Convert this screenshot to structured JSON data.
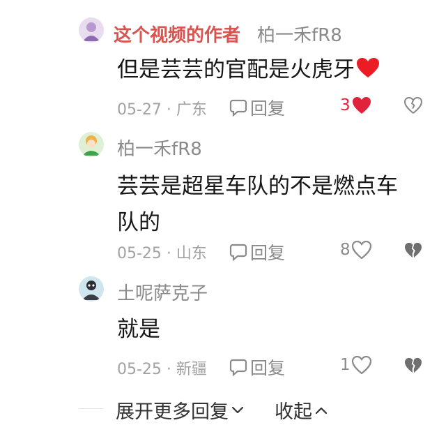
{
  "comments": [
    {
      "author_tag": "这个视频的作者",
      "reply_to": "柏一禾fR8",
      "text": "但是芸芸的官配是火虎牙",
      "date": "05-27",
      "location": "广东",
      "reply_label": "回复",
      "likes": "3"
    },
    {
      "name": "柏一禾fR8",
      "text_line1": "芸芸是超星车队的不是燃点车",
      "text_line2": "队的",
      "date": "05-25",
      "location": "山东",
      "reply_label": "回复",
      "likes": "8"
    },
    {
      "name": "土呢萨克子",
      "text": "就是",
      "date": "05-25",
      "location": "新疆",
      "reply_label": "回复",
      "likes": "1"
    }
  ],
  "footer": {
    "expand_label": "展开更多回复",
    "collapse_label": "收起"
  },
  "colors": {
    "liked_heart": "#e0223c",
    "author_tag": "#d9534f"
  }
}
